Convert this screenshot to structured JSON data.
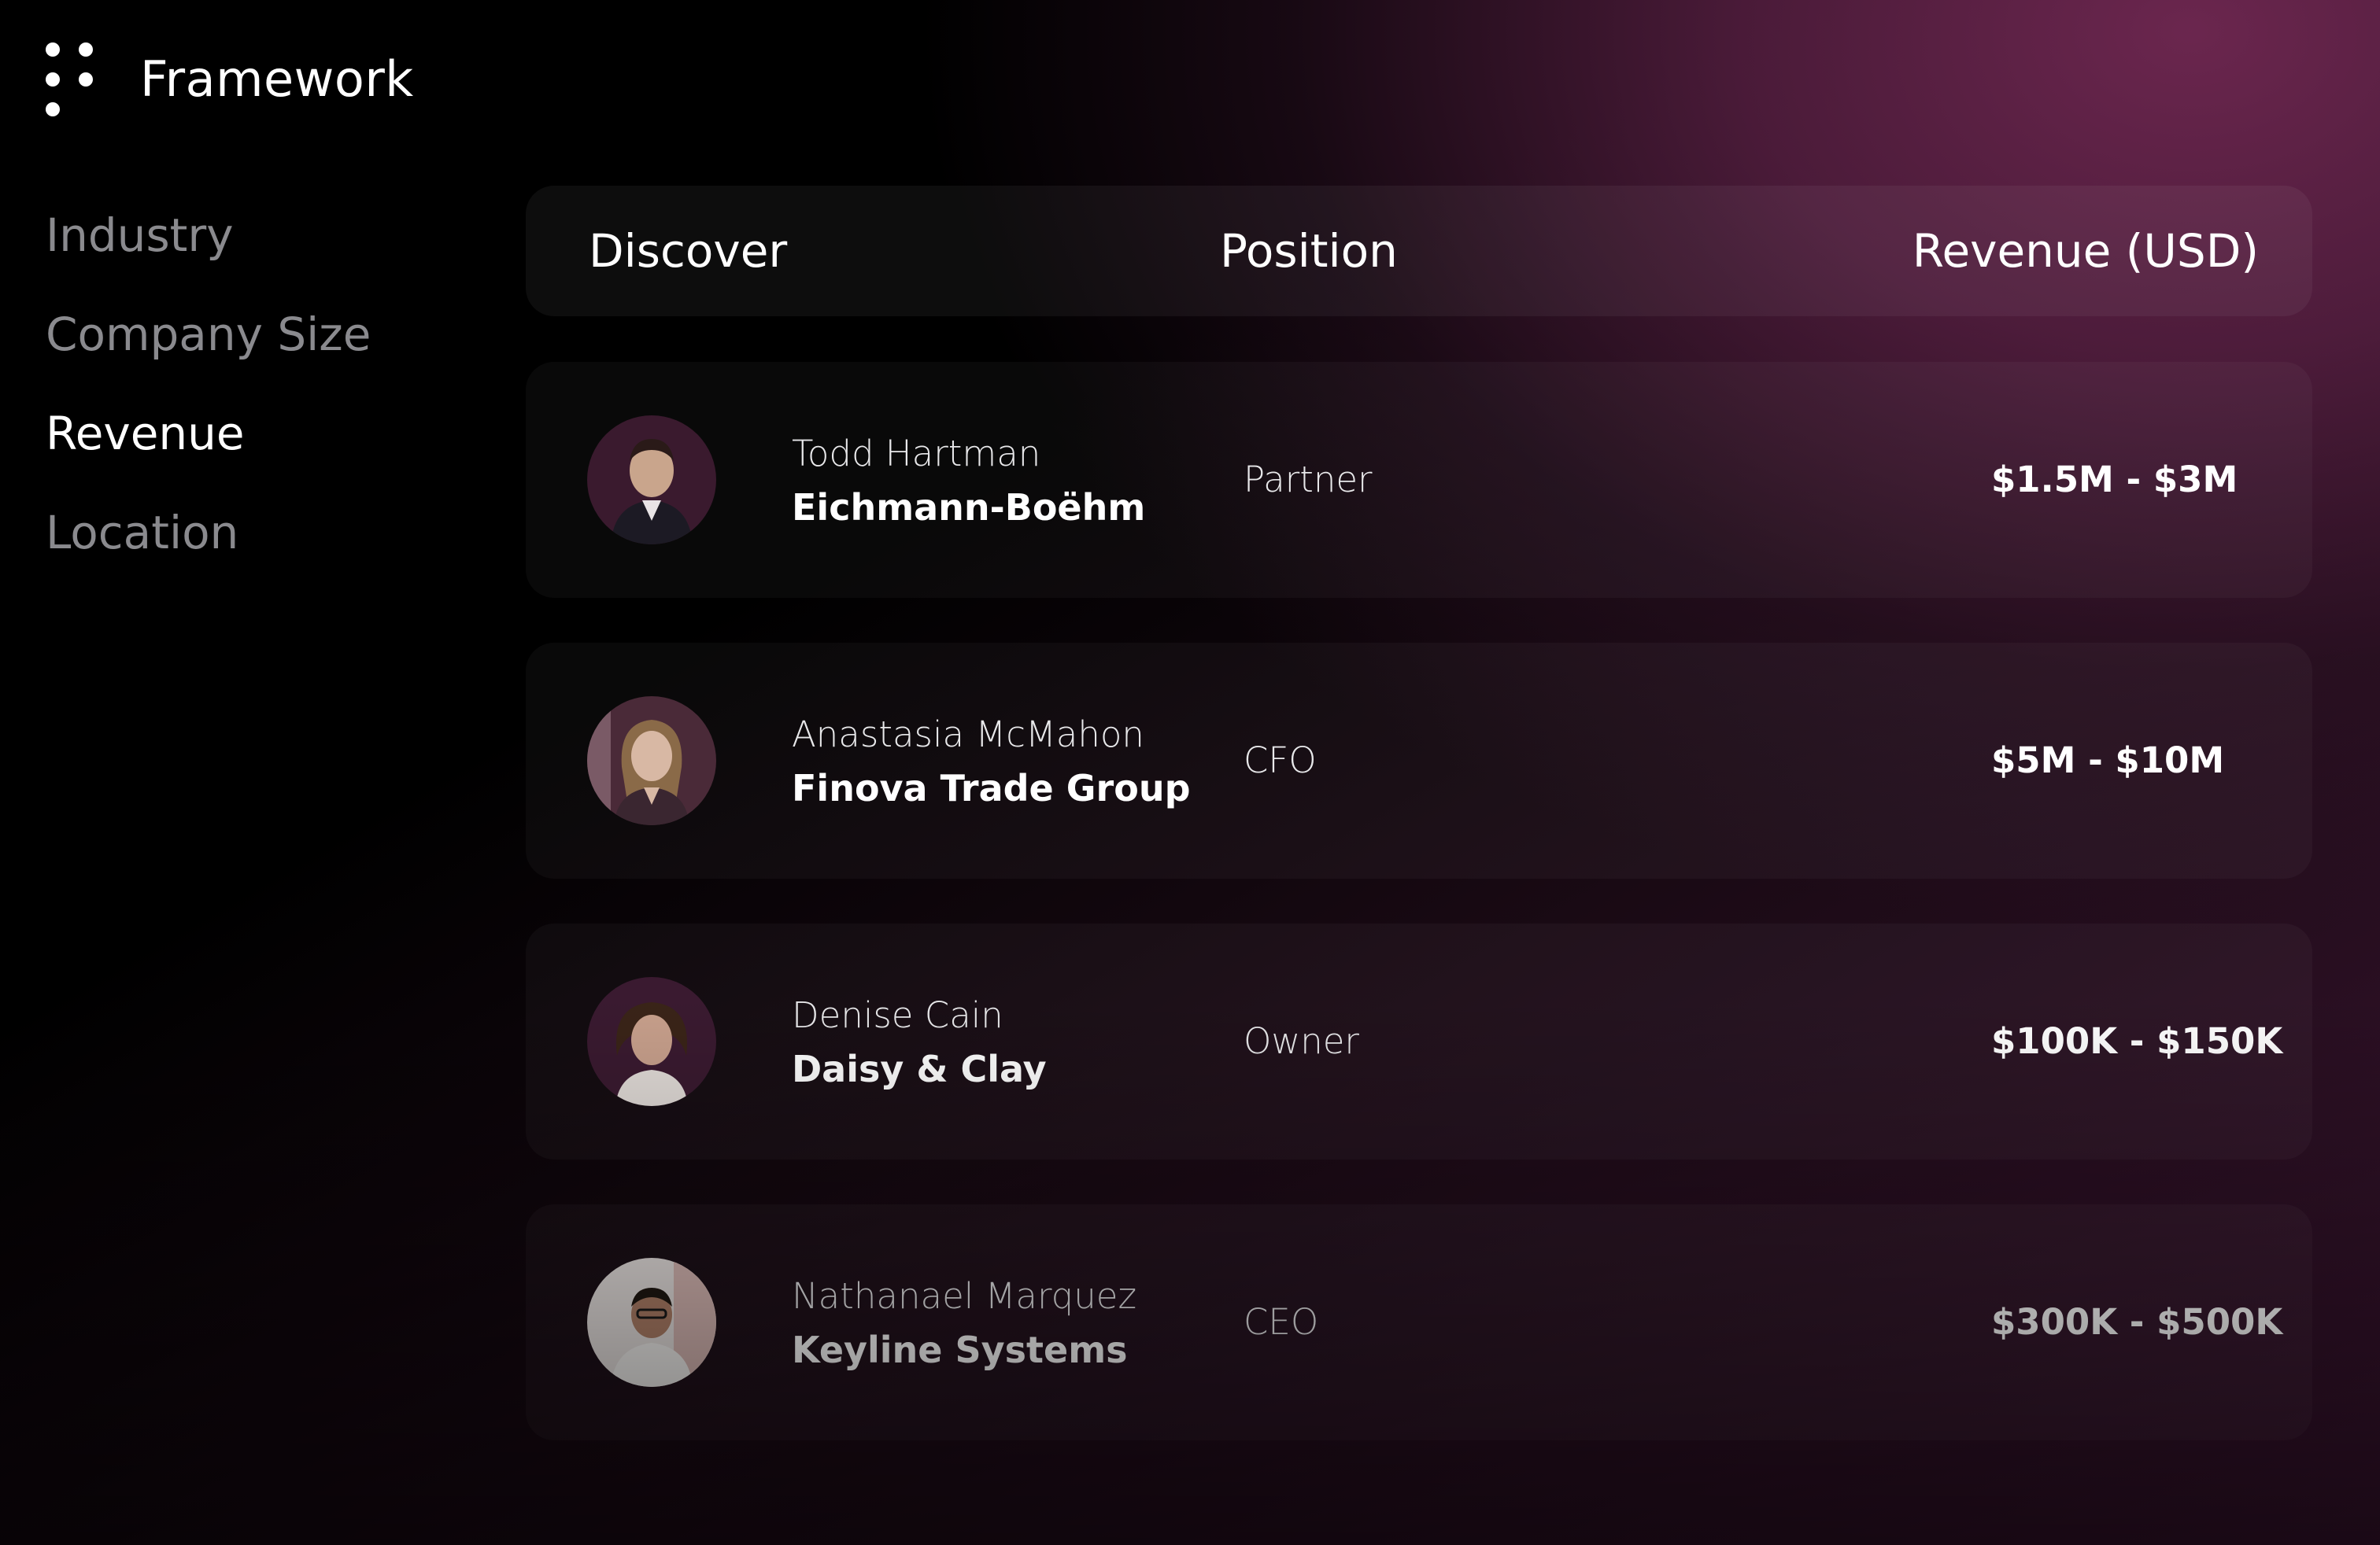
{
  "app": {
    "title": "Framework",
    "logo_icon": "dots-logo-icon"
  },
  "sidebar": {
    "items": [
      {
        "label": "Industry",
        "active": false
      },
      {
        "label": "Company Size",
        "active": false
      },
      {
        "label": "Revenue",
        "active": true
      },
      {
        "label": "Location",
        "active": false
      }
    ]
  },
  "table": {
    "headers": {
      "discover": "Discover",
      "position": "Position",
      "revenue": "Revenue (USD)"
    },
    "rows": [
      {
        "name": "Todd Hartman",
        "company": "Eichmann-Boëhm",
        "position": "Partner",
        "revenue": "$1.5M - $3M",
        "avatar": "person-avatar-icon"
      },
      {
        "name": "Anastasia McMahon",
        "company": "Finova Trade Group",
        "position": "CFO",
        "revenue": "$5M - $10M",
        "avatar": "person-avatar-icon"
      },
      {
        "name": "Denise Cain",
        "company": "Daisy & Clay",
        "position": "Owner",
        "revenue": "$100K - $150K",
        "avatar": "person-avatar-icon"
      },
      {
        "name": "Nathanael Marquez",
        "company": "Keyline Systems",
        "position": "CEO",
        "revenue": "$300K - $500K",
        "avatar": "person-avatar-icon"
      }
    ]
  },
  "colors": {
    "background": "#000000",
    "accent_magenta": "#6b2650",
    "text_primary": "#ffffff",
    "text_muted": "#8a8a8e"
  }
}
